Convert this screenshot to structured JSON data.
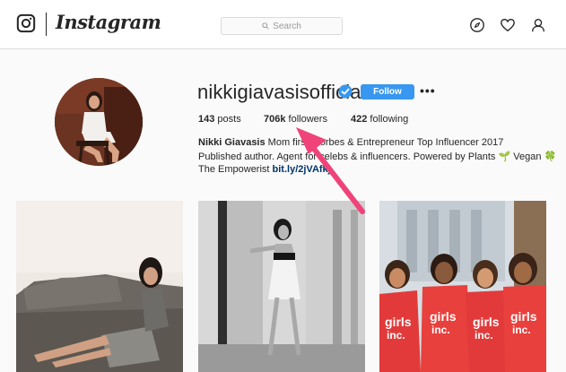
{
  "topbar": {
    "brand": "Instagram",
    "search_placeholder": "Search",
    "icons": [
      "instagram-glyph-icon",
      "search-icon",
      "compass-icon",
      "heart-icon",
      "user-icon"
    ]
  },
  "profile": {
    "username": "nikkigiavasisofficial",
    "verified": true,
    "follow_label": "Follow",
    "more_label": "•••",
    "stats": {
      "posts_count": "143",
      "posts_label": "posts",
      "followers_count": "706k",
      "followers_label": "followers",
      "following_count": "422",
      "following_label": "following"
    },
    "bio": {
      "name": "Nikki Giavasis",
      "line1_rest": " Mom first. Forbes & Entrepreneur Top Influencer 2017",
      "line2": "Published author. Agent for celebs & influencers. Powered by Plants 🌱 Vegan 🍀",
      "line3_text": "The Empowerist ",
      "link": "bit.ly/2jVAfkj"
    }
  },
  "posts": [
    {
      "alt": "woman-on-couch-photo"
    },
    {
      "alt": "woman-black-white-photo"
    },
    {
      "alt": "girls-inc-group-photo"
    }
  ],
  "colors": {
    "follow_blue": "#3897f0",
    "verified_blue": "#3897f0",
    "arrow_pink": "#f0437a",
    "link_blue": "#003569"
  }
}
